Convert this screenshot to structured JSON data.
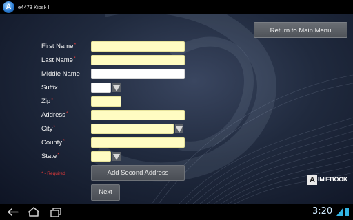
{
  "titlebar": {
    "app_name": "e4473 Kiosk II",
    "icon_letter": "A"
  },
  "header": {
    "return_label": "Return to Main Menu"
  },
  "form": {
    "fields": [
      {
        "label": "First Name",
        "required": true
      },
      {
        "label": "Last Name",
        "required": true
      },
      {
        "label": "Middle Name",
        "required": false
      },
      {
        "label": "Suffix",
        "required": false
      },
      {
        "label": "Zip",
        "required": true
      },
      {
        "label": "Address",
        "required": true
      },
      {
        "label": "City",
        "required": true
      },
      {
        "label": "County",
        "required": true
      },
      {
        "label": "State",
        "required": true
      }
    ],
    "required_marker": "*",
    "add_second_address_label": "Add Second Address",
    "required_note": "* - Required",
    "next_label": "Next"
  },
  "brand": {
    "logo_letter": "A",
    "wordmark": "IMIEBOOK"
  },
  "statusbar": {
    "time": "3:20"
  },
  "colors": {
    "field_yellow": "#fffcc2",
    "required_red": "#e23a3a",
    "background": "#202a3e"
  }
}
